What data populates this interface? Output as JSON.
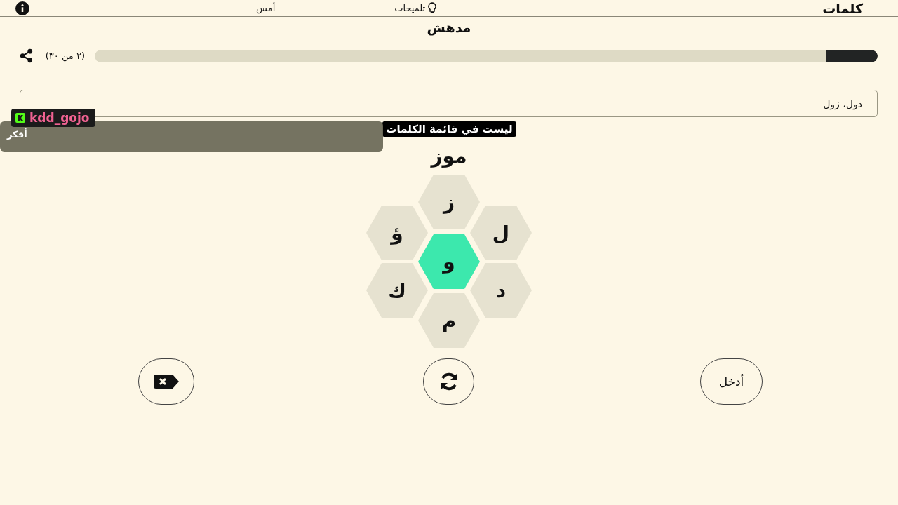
{
  "header": {
    "logo": "كلمات",
    "items": [
      {
        "label": "تلميحات",
        "kind": "hints"
      },
      {
        "label": "أمس",
        "kind": "yesterday"
      }
    ]
  },
  "rank": "مدهش",
  "progress": {
    "level": 0.065,
    "count": "(٢ من ٣٠)"
  },
  "found_words": "دول، زول",
  "toast": "ليست في قائمة الكلمات",
  "current_word": "موز",
  "letters": [
    {
      "letter": "ز",
      "kind": "outer"
    },
    {
      "letter": "ل",
      "kind": "outer"
    },
    {
      "letter": "ؤ",
      "kind": "outer"
    },
    {
      "letter": "و",
      "kind": "center"
    },
    {
      "letter": "د",
      "kind": "outer"
    },
    {
      "letter": "ك",
      "kind": "outer"
    },
    {
      "letter": "م",
      "kind": "outer"
    }
  ],
  "buttons": [
    {
      "kind": "delete"
    },
    {
      "kind": "shuffle"
    },
    {
      "kind": "enter",
      "label": "أدخل"
    }
  ],
  "overlay": {
    "user": "kdd_gojo",
    "message": "أفكر"
  }
}
